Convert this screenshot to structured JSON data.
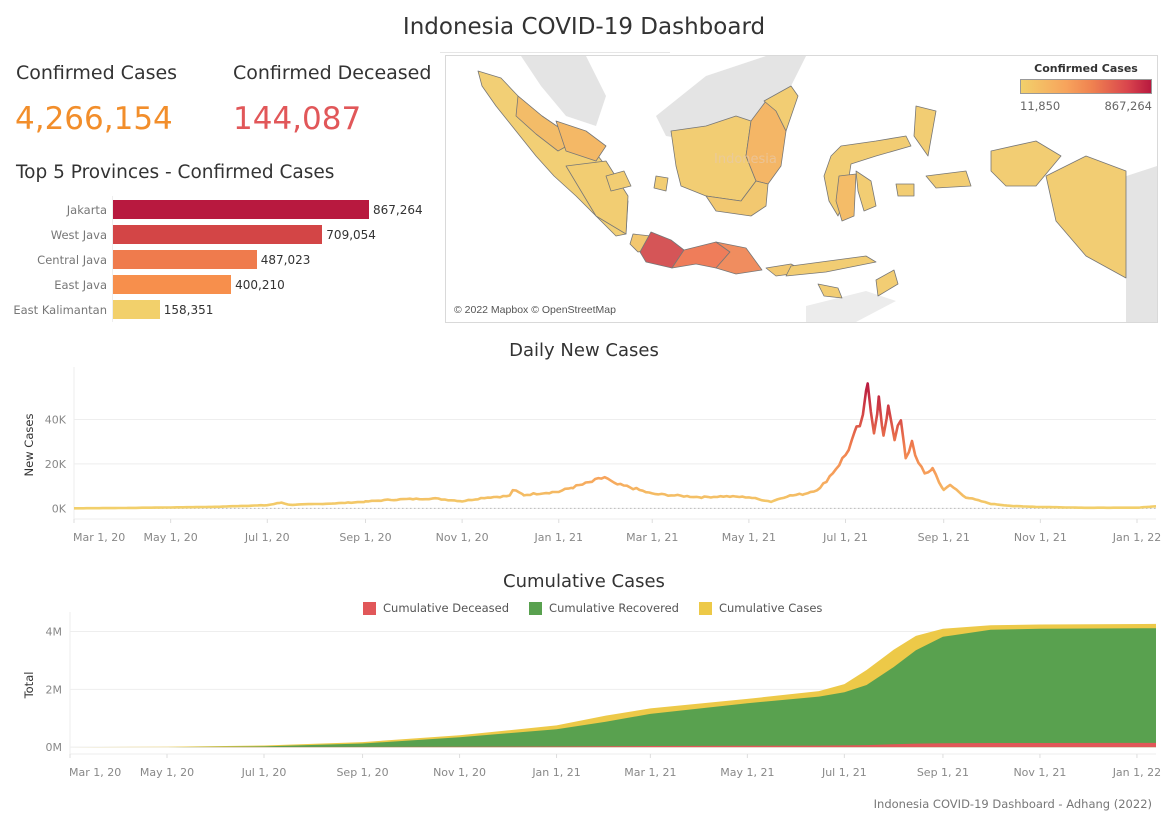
{
  "header": {
    "title": "Indonesia COVID-19 Dashboard"
  },
  "kpis": {
    "confirmed": {
      "label": "Confirmed Cases",
      "value": "4,266,154",
      "color": "#f28e2b"
    },
    "deceased": {
      "label": "Confirmed Deceased",
      "value": "144,087",
      "color": "#e15759"
    }
  },
  "map": {
    "credit": "© 2022 Mapbox © OpenStreetMap",
    "country_label": "Indonesia",
    "legend": {
      "title": "Confirmed Cases",
      "min": "11,850",
      "max": "867,264",
      "color_low": "#f2d06b",
      "color_high": "#b8193f"
    }
  },
  "footer": {
    "text": "Indonesia COVID-19 Dashboard - Adhang (2022)"
  },
  "chart_data": [
    {
      "id": "top5",
      "type": "bar",
      "orientation": "horizontal",
      "title": "Top 5 Provinces - Confirmed Cases",
      "categories": [
        "Jakarta",
        "West Java",
        "Central Java",
        "East Java",
        "East Kalimantan"
      ],
      "values": [
        867264,
        709054,
        487023,
        400210,
        158351
      ],
      "value_labels": [
        "867,264",
        "709,054",
        "487,023",
        "400,210",
        "158,351"
      ],
      "colors": [
        "#b8193f",
        "#d34546",
        "#ef7b4d",
        "#f78f4c",
        "#f2d06b"
      ],
      "xlim": [
        0,
        867264
      ]
    },
    {
      "id": "daily",
      "type": "line",
      "title": "Daily New Cases",
      "xlabel": "",
      "ylabel": "New Cases",
      "ylim": [
        -3000,
        60000
      ],
      "yticks": [
        0,
        20000,
        40000
      ],
      "ytick_labels": [
        "0K",
        "20K",
        "40K"
      ],
      "xlim": [
        "2020-03-01",
        "2022-01-13"
      ],
      "xticks": [
        "2020-03-01",
        "2020-05-01",
        "2020-07-01",
        "2020-09-01",
        "2020-11-01",
        "2021-01-01",
        "2021-03-01",
        "2021-05-01",
        "2021-07-01",
        "2021-09-01",
        "2021-11-01",
        "2022-01-01"
      ],
      "xtick_labels": [
        "Mar 1, 20",
        "May 1, 20",
        "Jul 1, 20",
        "Sep 1, 20",
        "Nov 1, 20",
        "Jan 1, 21",
        "Mar 1, 21",
        "May 1, 21",
        "Jul 1, 21",
        "Sep 1, 21",
        "Nov 1, 21",
        "Jan 1, 22"
      ],
      "color_scale": [
        "#f2d06b",
        "#f7a35c",
        "#ef7b4d",
        "#d34546",
        "#b8193f"
      ],
      "series": [
        {
          "name": "New Cases",
          "points": [
            [
              "2020-03-01",
              0
            ],
            [
              "2020-04-01",
              150
            ],
            [
              "2020-05-01",
              400
            ],
            [
              "2020-06-01",
              700
            ],
            [
              "2020-06-15",
              1100
            ],
            [
              "2020-07-01",
              1400
            ],
            [
              "2020-07-10",
              2600
            ],
            [
              "2020-07-15",
              1600
            ],
            [
              "2020-08-01",
              1900
            ],
            [
              "2020-08-15",
              2300
            ],
            [
              "2020-09-01",
              3000
            ],
            [
              "2020-09-15",
              3800
            ],
            [
              "2020-10-01",
              4200
            ],
            [
              "2020-10-15",
              4400
            ],
            [
              "2020-11-01",
              3200
            ],
            [
              "2020-11-15",
              4800
            ],
            [
              "2020-12-01",
              5600
            ],
            [
              "2020-12-03",
              8300
            ],
            [
              "2020-12-10",
              6000
            ],
            [
              "2020-12-20",
              6800
            ],
            [
              "2021-01-01",
              7500
            ],
            [
              "2021-01-10",
              9500
            ],
            [
              "2021-01-20",
              11500
            ],
            [
              "2021-01-30",
              14000
            ],
            [
              "2021-02-05",
              11000
            ],
            [
              "2021-02-15",
              9500
            ],
            [
              "2021-03-01",
              6500
            ],
            [
              "2021-03-15",
              5800
            ],
            [
              "2021-04-01",
              5000
            ],
            [
              "2021-04-15",
              5400
            ],
            [
              "2021-05-01",
              5000
            ],
            [
              "2021-05-15",
              3000
            ],
            [
              "2021-05-25",
              5500
            ],
            [
              "2021-06-05",
              6500
            ],
            [
              "2021-06-15",
              9000
            ],
            [
              "2021-06-25",
              18000
            ],
            [
              "2021-07-01",
              24000
            ],
            [
              "2021-07-08",
              35000
            ],
            [
              "2021-07-12",
              40000
            ],
            [
              "2021-07-15",
              56757
            ],
            [
              "2021-07-19",
              35000
            ],
            [
              "2021-07-22",
              49000
            ],
            [
              "2021-07-25",
              31000
            ],
            [
              "2021-07-28",
              47000
            ],
            [
              "2021-08-01",
              32000
            ],
            [
              "2021-08-05",
              39000
            ],
            [
              "2021-08-08",
              22000
            ],
            [
              "2021-08-12",
              30000
            ],
            [
              "2021-08-16",
              20000
            ],
            [
              "2021-08-20",
              15500
            ],
            [
              "2021-08-25",
              18000
            ],
            [
              "2021-09-01",
              8000
            ],
            [
              "2021-09-05",
              10500
            ],
            [
              "2021-09-15",
              5000
            ],
            [
              "2021-10-01",
              2000
            ],
            [
              "2021-10-15",
              1000
            ],
            [
              "2021-11-01",
              600
            ],
            [
              "2021-12-01",
              250
            ],
            [
              "2022-01-01",
              300
            ],
            [
              "2022-01-13",
              900
            ]
          ]
        }
      ]
    },
    {
      "id": "cumulative",
      "type": "area",
      "stacked": false,
      "title": "Cumulative Cases",
      "xlabel": "",
      "ylabel": "Total",
      "ylim": [
        -100000,
        4400000
      ],
      "yticks": [
        0,
        2000000,
        4000000
      ],
      "ytick_labels": [
        "0M",
        "2M",
        "4M"
      ],
      "xlim": [
        "2020-03-01",
        "2022-01-13"
      ],
      "xticks": [
        "2020-03-01",
        "2020-05-01",
        "2020-07-01",
        "2020-09-01",
        "2020-11-01",
        "2021-01-01",
        "2021-03-01",
        "2021-05-01",
        "2021-07-01",
        "2021-09-01",
        "2021-11-01",
        "2022-01-01"
      ],
      "xtick_labels": [
        "Mar 1, 20",
        "May 1, 20",
        "Jul 1, 20",
        "Sep 1, 20",
        "Nov 1, 20",
        "Jan 1, 21",
        "Mar 1, 21",
        "May 1, 21",
        "Jul 1, 21",
        "Sep 1, 21",
        "Nov 1, 21",
        "Jan 1, 22"
      ],
      "legend_position": "top-center",
      "dates": [
        "2020-03-01",
        "2020-05-01",
        "2020-07-01",
        "2020-09-01",
        "2020-11-01",
        "2021-01-01",
        "2021-02-01",
        "2021-03-01",
        "2021-05-01",
        "2021-06-15",
        "2021-07-01",
        "2021-07-15",
        "2021-08-01",
        "2021-08-15",
        "2021-09-01",
        "2021-10-01",
        "2021-11-01",
        "2022-01-13"
      ],
      "series": [
        {
          "name": "Cumulative Cases",
          "color": "#edc948",
          "values": [
            0,
            10000,
            57000,
            175000,
            410000,
            751000,
            1090000,
            1340000,
            1670000,
            1940000,
            2180000,
            2670000,
            3370000,
            3850000,
            4100000,
            4220000,
            4245000,
            4266154
          ]
        },
        {
          "name": "Cumulative Recovered",
          "color": "#59a14f",
          "values": [
            0,
            2000,
            25000,
            125000,
            340000,
            620000,
            880000,
            1150000,
            1520000,
            1750000,
            1900000,
            2150000,
            2770000,
            3350000,
            3820000,
            4060000,
            4100000,
            4117000
          ]
        },
        {
          "name": "Cumulative Deceased",
          "color": "#e15759",
          "values": [
            0,
            800,
            3000,
            7500,
            13800,
            22000,
            30000,
            37000,
            46000,
            53000,
            58000,
            71000,
            96000,
            120000,
            134000,
            142000,
            143500,
            144087
          ]
        }
      ],
      "legend": [
        "Cumulative Deceased",
        "Cumulative Recovered",
        "Cumulative Cases"
      ]
    }
  ]
}
